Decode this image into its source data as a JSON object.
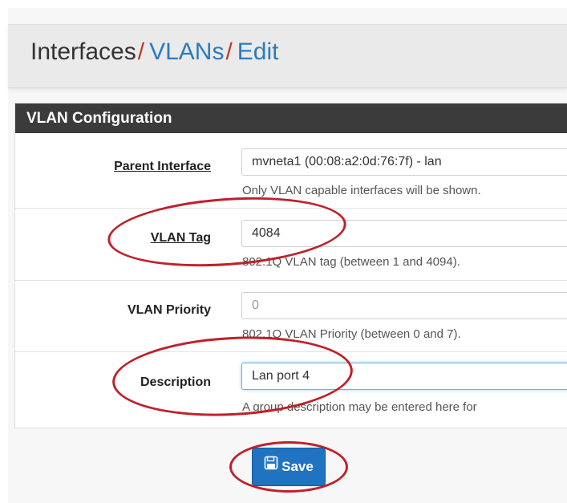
{
  "breadcrumb": {
    "items": [
      "Interfaces",
      "VLANs",
      "Edit"
    ],
    "separator": "/"
  },
  "panel": {
    "title": "VLAN Configuration",
    "rows": {
      "parent_interface": {
        "label": "Parent Interface",
        "value": "mvneta1 (00:08:a2:0d:76:7f) - lan",
        "help": "Only VLAN capable interfaces will be shown."
      },
      "vlan_tag": {
        "label": "VLAN Tag",
        "value": "4084",
        "help": "802.1Q VLAN tag (between 1 and 4094)."
      },
      "vlan_priority": {
        "label": "VLAN Priority",
        "value": "0",
        "help": "802.1Q VLAN Priority (between 0 and 7)."
      },
      "description": {
        "label": "Description",
        "value": "Lan port 4",
        "help": "A group description may be entered here for"
      }
    }
  },
  "save_button": {
    "label": "Save",
    "icon": "save-icon"
  },
  "colors": {
    "accent_link": "#2a7bbf",
    "separator": "#c0392b",
    "panel_header": "#3b3b3b",
    "button": "#1f73c0",
    "annotation": "#c0202a"
  }
}
